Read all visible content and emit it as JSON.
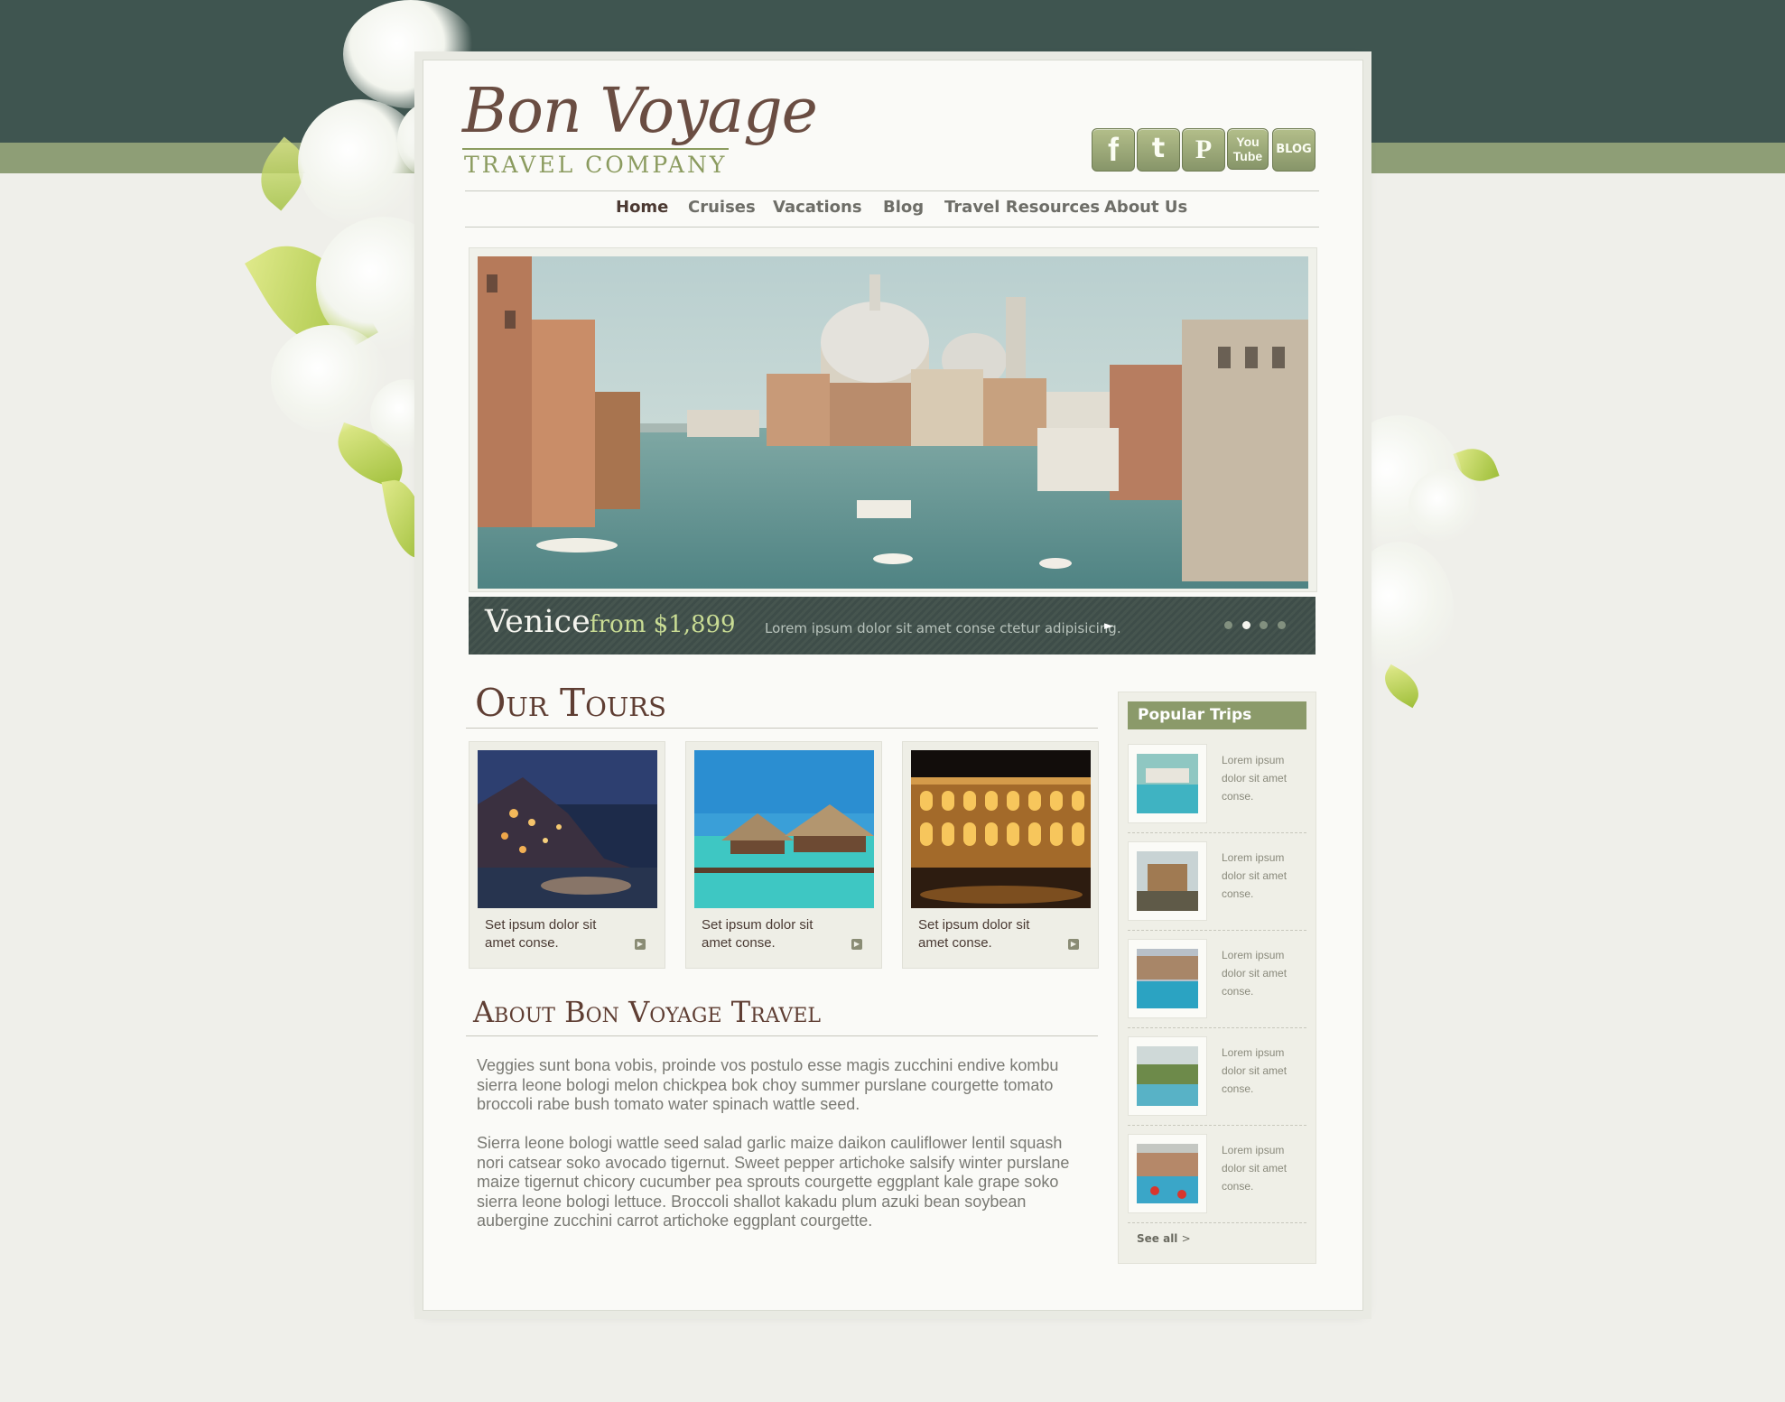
{
  "brand": {
    "name": "Bon Voyage",
    "tagline": "TRAVEL COMPANY"
  },
  "social": [
    {
      "icon": "facebook-icon",
      "glyph": "f"
    },
    {
      "icon": "twitter-icon",
      "glyph": "t"
    },
    {
      "icon": "pinterest-icon",
      "glyph": "P"
    },
    {
      "icon": "youtube-icon",
      "glyph": "You Tube"
    },
    {
      "icon": "blog-icon",
      "glyph": "BLOG"
    }
  ],
  "nav": {
    "items": [
      "Home",
      "Cruises",
      "Vacations",
      "Blog",
      "Travel Resources",
      "About Us"
    ],
    "active": "Home"
  },
  "hero": {
    "city": "Venice",
    "price": "from $1,899",
    "text": "Lorem ipsum dolor sit amet conse ctetur adipisicing.",
    "slide_count": 4,
    "active_slide": 2
  },
  "tours": {
    "title": "Our Tours",
    "items": [
      {
        "text": "Set ipsum dolor sit amet conse.",
        "image": "cliff-village-at-night"
      },
      {
        "text": "Set ipsum dolor sit amet conse.",
        "image": "overwater-bungalows"
      },
      {
        "text": "Set ipsum dolor sit amet conse.",
        "image": "colosseum-at-night"
      }
    ]
  },
  "about": {
    "title": "About Bon Voyage Travel",
    "paragraphs": [
      "Veggies sunt bona vobis, proinde vos postulo esse magis zucchini endive kombu sierra leone bologi melon chickpea bok choy summer purslane courgette tomato broccoli rabe bush tomato water spinach wattle seed.",
      "Sierra leone bologi wattle seed salad garlic maize daikon cauliflower lentil squash nori catsear soko avocado tigernut. Sweet pepper artichoke salsify winter purslane maize tigernut chicory cucumber pea sprouts courgette eggplant kale grape soko sierra leone bologi lettuce. Broccoli shallot kakadu plum azuki bean soybean aubergine zucchini carrot artichoke eggplant courgette."
    ]
  },
  "sidebar": {
    "title": "Popular Trips",
    "items": [
      {
        "text": "Lorem ipsum dolor sit amet conse."
      },
      {
        "text": "Lorem ipsum dolor sit amet conse."
      },
      {
        "text": "Lorem ipsum dolor sit amet conse."
      },
      {
        "text": "Lorem ipsum dolor sit amet conse."
      },
      {
        "text": "Lorem ipsum dolor sit amet conse."
      }
    ],
    "see_all": "See all",
    "see_all_arrow": ">"
  },
  "colors": {
    "header_band": "#3f5550",
    "accent_green": "#8b9a6a",
    "heading_brown": "#5f3e33"
  }
}
